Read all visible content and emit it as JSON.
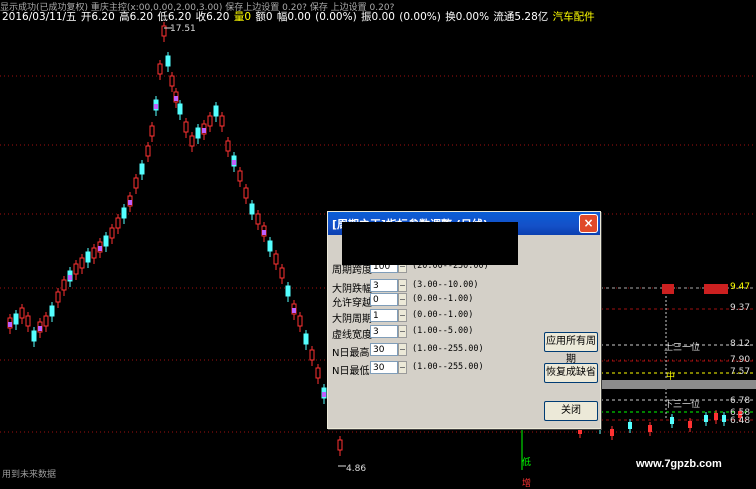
{
  "header": {
    "top_line": "显示成功(已成功复权) 重庆主控(x:00,0.00,2.00,3.00) 保存上边设置 0.20? 保存 上边设置 0.20?",
    "date": "2016/03/11/五",
    "open": "开6.20",
    "high": "高6.20",
    "low": "低6.20",
    "close": "收6.20",
    "volume": "量0",
    "amount": "额0",
    "change": "幅0.00",
    "change_pct": "(0.00%)",
    "amplitude": "振0.00",
    "amplitude_pct": "(0.00%)",
    "turnover": "换0.00%",
    "float_cap": "流通5.28亿",
    "sector": "汽车配件"
  },
  "chart": {
    "high_marker": "17.51",
    "low_marker": "4.86",
    "right_labels": [
      "9.37",
      "8.12",
      "7.90",
      "7.57",
      "6.78",
      "6.58",
      "6.48"
    ],
    "right_text_top": "上三一位",
    "right_text_mid": "中",
    "right_text_bottom": "下三一位",
    "right_price_tag": "9.47",
    "bottom_tag": "低",
    "bottom_tag2": "增",
    "footer": "用到未来数据",
    "watermark": "www.7gpzb.com",
    "colors": {
      "up": "#ff3232",
      "down": "#54ffff",
      "grid_red": "#a01010",
      "purple": "#c060ff",
      "yellow": "#ffff00",
      "green": "#00ff00"
    }
  },
  "dialog": {
    "title": "[周期之王]指标参数调整 (日线)",
    "close_icon": "×",
    "rows": [
      {
        "label": "周期跨度:",
        "value": "100",
        "range": "(20.00--250.00)"
      },
      {
        "label": "大阴跌幅:",
        "value": "3",
        "range": "(3.00--10.00)"
      },
      {
        "label": "允许穿越:",
        "value": "0",
        "range": "(0.00--1.00)"
      },
      {
        "label": "大阴周期:",
        "value": "1",
        "range": "(0.00--1.00)"
      },
      {
        "label": "虚线宽度:",
        "value": "3",
        "range": "(1.00--5.00)"
      },
      {
        "label": "N日最高:",
        "value": "30",
        "range": "(1.00--255.00)"
      },
      {
        "label": "N日最低:",
        "value": "30",
        "range": "(1.00--255.00)"
      }
    ],
    "buttons": {
      "apply_all": "应用所有周期",
      "restore": "恢复成缺省",
      "close": "关闭"
    }
  }
}
